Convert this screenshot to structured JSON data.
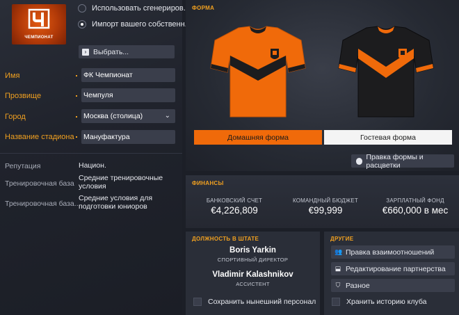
{
  "left": {
    "logo_text": "ЧЕМПИОНАТ",
    "radio_generated": "Использовать сгенериров...",
    "radio_import": "Импорт вашего собственн...",
    "choose_button": "Выбрать...",
    "fields": {
      "name_label": "Имя",
      "name_value": "ФК Чемпионат",
      "nickname_label": "Прозвище",
      "nickname_value": "Чемпуля",
      "city_label": "Город",
      "city_value": "Москва (столица)",
      "stadium_label": "Название стадиона",
      "stadium_value": "Мануфактура"
    },
    "info": {
      "reputation_label": "Репутация",
      "reputation_value": "Национ.",
      "training_label": "Тренировочная база",
      "training_value": "Средние тренировочные условия",
      "youth_label": "Тренировочная база...",
      "youth_value": "Средние условия для подготовки юниоров"
    }
  },
  "kit": {
    "header": "ФОРМА",
    "home_button": "Домашняя форма",
    "away_button": "Гостевая форма",
    "edit_button": "Правка формы и расцветки",
    "colors": {
      "orange": "#f06a0a",
      "black": "#1c1c1e"
    }
  },
  "finances": {
    "header": "ФИНАНСЫ",
    "bank_label": "БАНКОВСКИЙ СЧЕТ",
    "bank_value": "€4,226,809",
    "transfer_label": "КОМАНДНЫЙ БЮДЖЕТ",
    "transfer_value": "€99,999",
    "wage_label": "ЗАРПЛАТНЫЙ ФОНД",
    "wage_value": "€660,000 в мес"
  },
  "staff": {
    "header": "ДОЛЖНОСТЬ В ШТАТЕ",
    "people": [
      {
        "name": "Boris Yarkin",
        "role": "СПОРТИВНЫЙ ДИРЕКТОР"
      },
      {
        "name": "Vladimir Kalashnikov",
        "role": "АССИСТЕНТ"
      }
    ],
    "keep_label": "Сохранить нынешний персонал"
  },
  "other": {
    "header": "ДРУГИЕ",
    "relations_button": "Правка взаимоотношений",
    "partnership_button": "Редактирование партнерства",
    "misc_button": "Разное",
    "history_label": "Хранить историю клуба"
  },
  "accent": "#f0a020"
}
